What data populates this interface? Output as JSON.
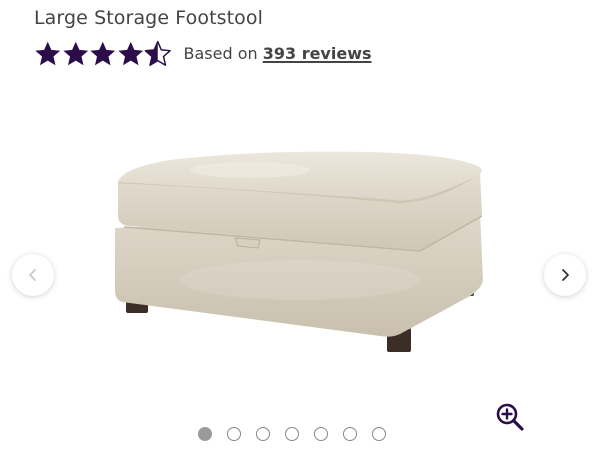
{
  "product": {
    "title": "Large Storage Footstool",
    "rating": {
      "value": 4.5,
      "max": 5,
      "prefix": "Based on ",
      "reviews_link": "393 reviews"
    }
  },
  "colors": {
    "star": "#2b0d4a",
    "accent": "#2b0d4a"
  },
  "gallery": {
    "image_alt": "Large Storage Footstool",
    "slide_count": 7,
    "active_slide": 1,
    "prev_icon": "chevron-left-icon",
    "next_icon": "chevron-right-icon",
    "zoom_icon": "zoom-in-icon"
  }
}
